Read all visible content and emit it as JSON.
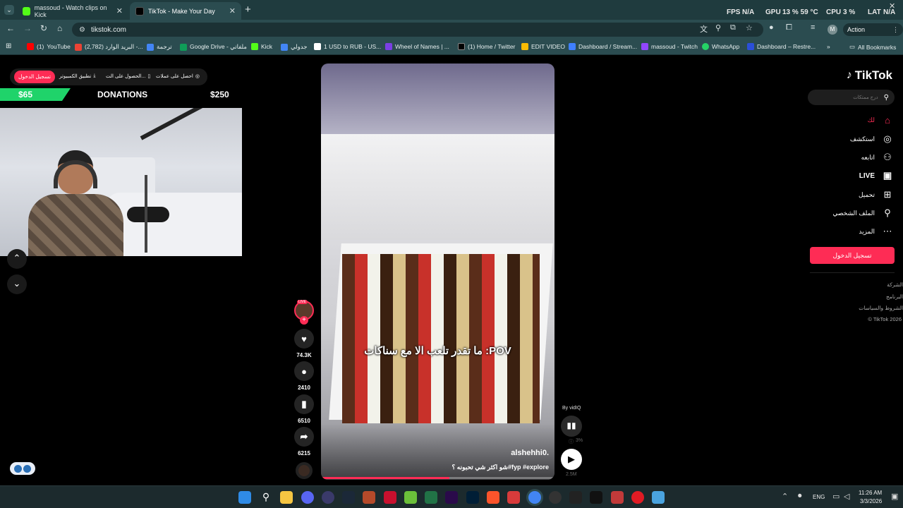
{
  "browser": {
    "tabs": [
      {
        "title": "massoud - Watch clips on Kick",
        "favicon_color": "#53fc18"
      },
      {
        "title": "TikTok - Make Your Day",
        "favicon_color": "#000000"
      }
    ],
    "new_tab": "+",
    "url": "tikstok.com",
    "action_required": "Action required",
    "profile_initial": "M",
    "all_bookmarks": "All Bookmarks",
    "bookmarks": [
      {
        "label": "YouTube",
        "count": "(1)",
        "color": "#ff0000"
      },
      {
        "label": "(2,782) البريد الوارد -...",
        "color": "#ea4335"
      },
      {
        "label": "ترجمة",
        "color": "#4285f4"
      },
      {
        "label": "Google Drive - ملفاتي",
        "color": "#0f9d58"
      },
      {
        "label": "Kick",
        "color": "#53fc18"
      },
      {
        "label": "جدولي",
        "color": "#4285f4"
      },
      {
        "label": "1 USD to RUB - US...",
        "color": "#ffffff"
      },
      {
        "label": "Wheel of Names | ...",
        "color": "#7b3fe4"
      },
      {
        "label": "(1) Home / Twitter",
        "color": "#000000"
      },
      {
        "label": "EDIT VIDEO",
        "color": "#fbbc04"
      },
      {
        "label": "Dashboard / Stream...",
        "color": "#3f7fff"
      },
      {
        "label": "massoud - Twitch",
        "color": "#9146ff"
      },
      {
        "label": "WhatsApp",
        "color": "#25d366"
      },
      {
        "label": "Dashboard – Restre...",
        "color": "#2b4fd8"
      }
    ],
    "hud": {
      "fps": "FPS",
      "fps_val": "N/A",
      "gpu": "GPU",
      "gpu_val": "13 % 59 °C",
      "cpu": "CPU",
      "cpu_val": "3 %",
      "lat": "LAT",
      "lat_val": "N/A"
    }
  },
  "overlay": {
    "donations": "DONATIONS",
    "left_amount": "$65",
    "right_amount": "$250",
    "tiktok_topbar": {
      "login": "تسجيل الدخول",
      "download_app": "تطبيق الكمبيوتر",
      "get_app": "الحصول على الت...",
      "coins": "احصل على عملات"
    }
  },
  "tiktok": {
    "logo": "TikTok",
    "search_placeholder": "درج ممتكات",
    "nav": [
      {
        "label": "لك",
        "icon": "home"
      },
      {
        "label": "استكشف",
        "icon": "compass"
      },
      {
        "label": "اتابعه",
        "icon": "user-plus"
      },
      {
        "label": "LIVE",
        "icon": "live"
      },
      {
        "label": "تحميل",
        "icon": "upload"
      },
      {
        "label": "الملف الشخصي",
        "icon": "profile"
      },
      {
        "label": "المزيد",
        "icon": "more"
      }
    ],
    "login_button": "تسجيل الدخول",
    "footer": [
      "الشركة",
      "البرنامج",
      "الشروط والسياسات",
      "© TikTok 2026"
    ],
    "video": {
      "caption_overlay": "ما تقدر تلعب الا مع سناكات :POV",
      "username": "alshehhi0.",
      "description": "شو اكثر شي تحبونه ؟#fyp #explore",
      "by": "By vidIQ",
      "stat1": "3%",
      "stat2": "2.5M",
      "progress": 0.55
    },
    "actions": {
      "live": "LIVE",
      "likes": "74.3K",
      "comments": "2410",
      "saves": "6510",
      "shares": "6215"
    }
  },
  "taskbar": {
    "lang": "ENG",
    "time": "11:26 AM",
    "date": "3/3/2026"
  }
}
